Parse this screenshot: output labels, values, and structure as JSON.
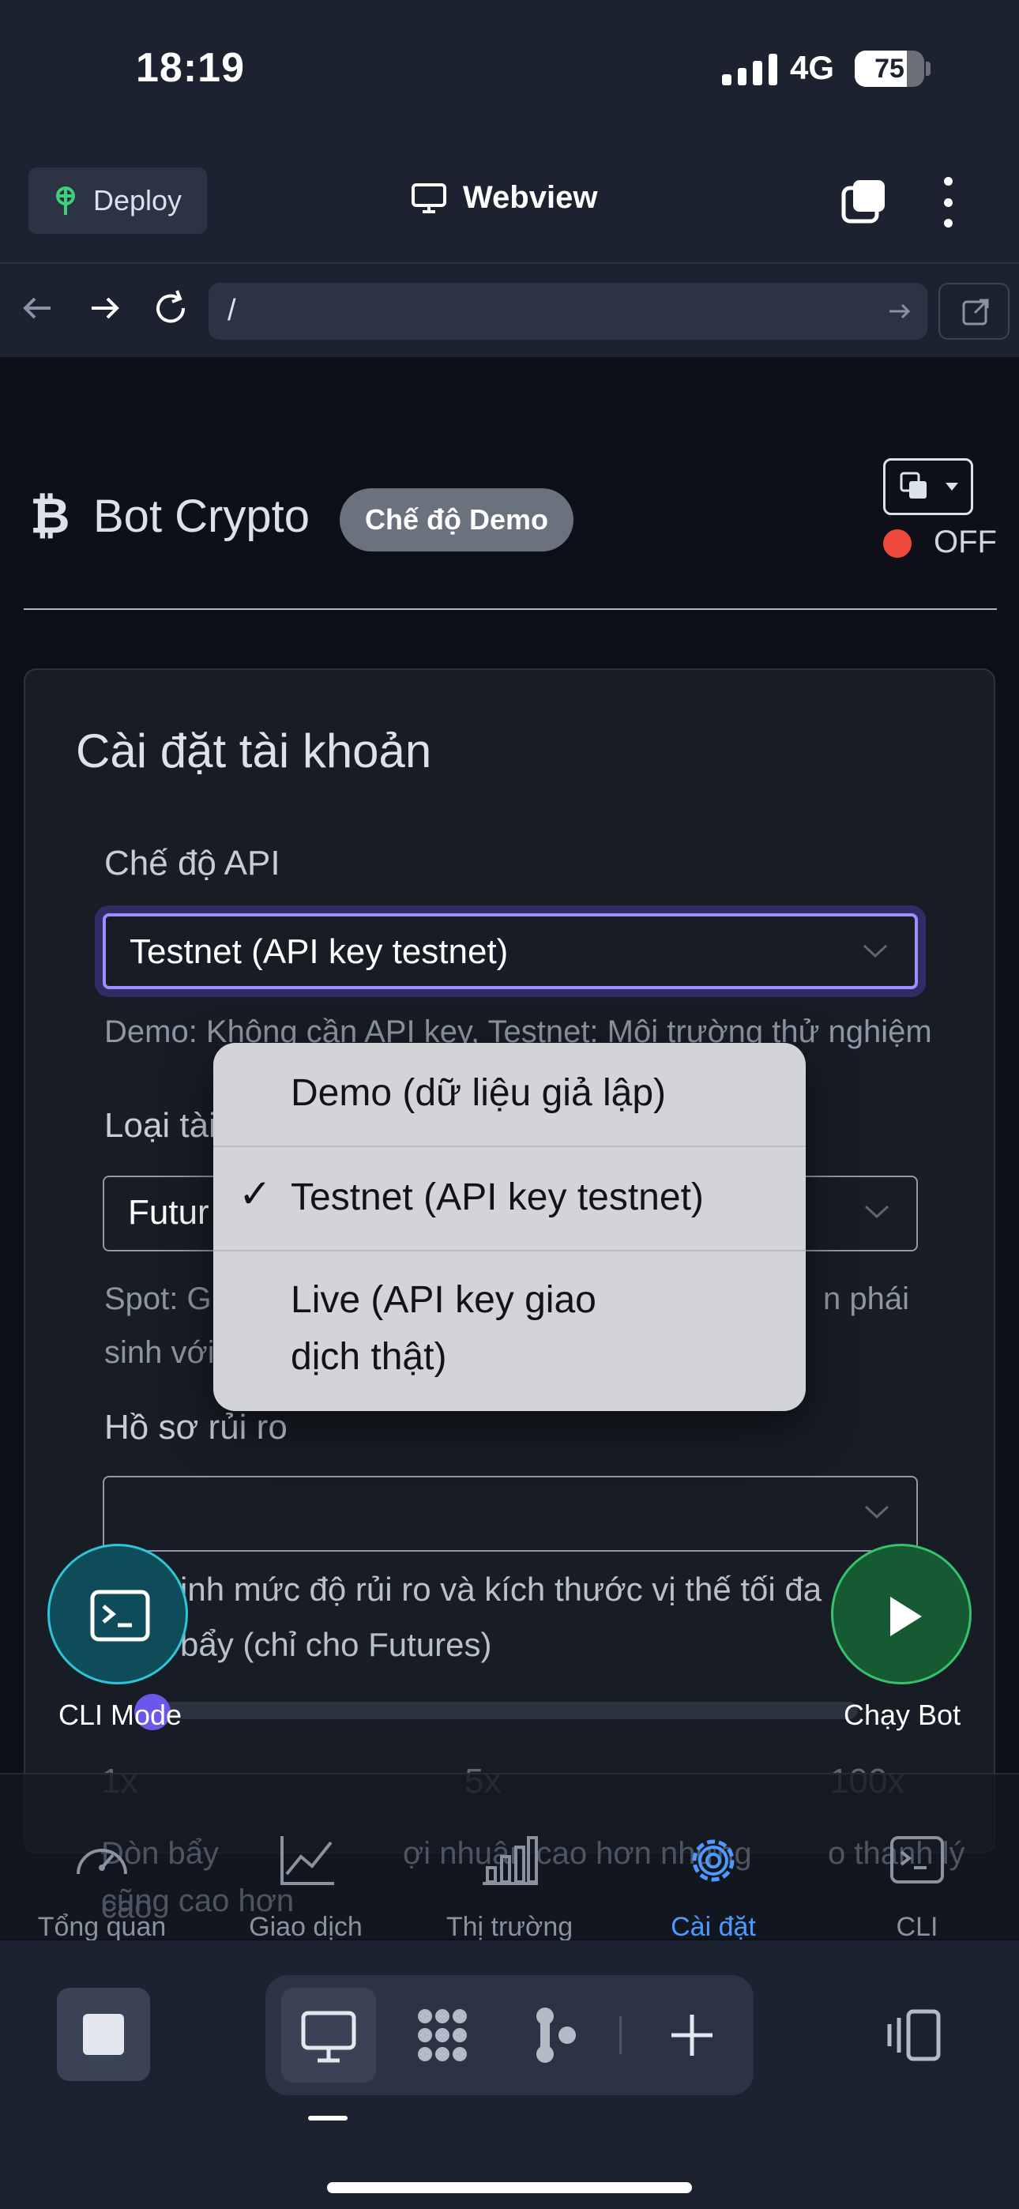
{
  "status_bar": {
    "time": "18:19",
    "network": "4G",
    "battery": "75",
    "battery_level": 0.75
  },
  "top_bar": {
    "deploy_label": "Deploy",
    "title": "Webview"
  },
  "url_bar": {
    "url": "/"
  },
  "app": {
    "title": "Bot Crypto",
    "mode_badge": "Chế độ Demo",
    "bot_status": "OFF"
  },
  "card": {
    "title": "Cài đặt tài khoản",
    "api_mode": {
      "label": "Chế độ API",
      "value": "Testnet (API key testnet)",
      "help": "Demo: Không cần API key, Testnet: Môi trường thử nghiệm"
    },
    "account_type": {
      "label": "Loại tài",
      "value": "Futur",
      "help_left": "Spot: G",
      "help_right": "n phái",
      "help_line2": "sinh với"
    },
    "risk_profile": {
      "label": "Hồ sơ rủi ro",
      "value": "",
      "help_line1": "inh mức độ rủi ro và kích thước vị thế tối đa",
      "help_line2": "bẩy (chỉ cho Futures)"
    },
    "leverage": {
      "min_label": "1x",
      "mid_label": "5x",
      "max_label": "100x",
      "note_line1": "Đòn bẩy cao",
      "note_mid": "ợi nhuận cao hơn nhưng",
      "note_right": "o thanh lý",
      "note_line2": "cũng cao hơn"
    }
  },
  "floating": {
    "cli_label": "CLI Mode",
    "run_label": "Chạy Bot"
  },
  "bottom_nav": [
    {
      "label": "Tổng quan",
      "icon": "gauge-icon"
    },
    {
      "label": "Giao dịch",
      "icon": "line-chart-icon"
    },
    {
      "label": "Thị trường",
      "icon": "bar-chart-icon"
    },
    {
      "label": "Cài đặt",
      "icon": "gear-icon",
      "active": true
    },
    {
      "label": "CLI",
      "icon": "terminal-icon"
    }
  ],
  "dropdown": {
    "options": [
      {
        "label": "Demo (dữ liệu giả lập)",
        "selected": false
      },
      {
        "label": "Testnet (API key testnet)",
        "selected": true
      },
      {
        "label_line1": "Live (API key giao",
        "label_line2": "dịch thật)",
        "selected": false
      }
    ],
    "check_mark": "✓"
  },
  "colors": {
    "accent": "#4c9aff",
    "focus": "#9c8fff",
    "status_off": "#f0493e",
    "run": "#34c36a",
    "cli": "#2cc6d8"
  }
}
